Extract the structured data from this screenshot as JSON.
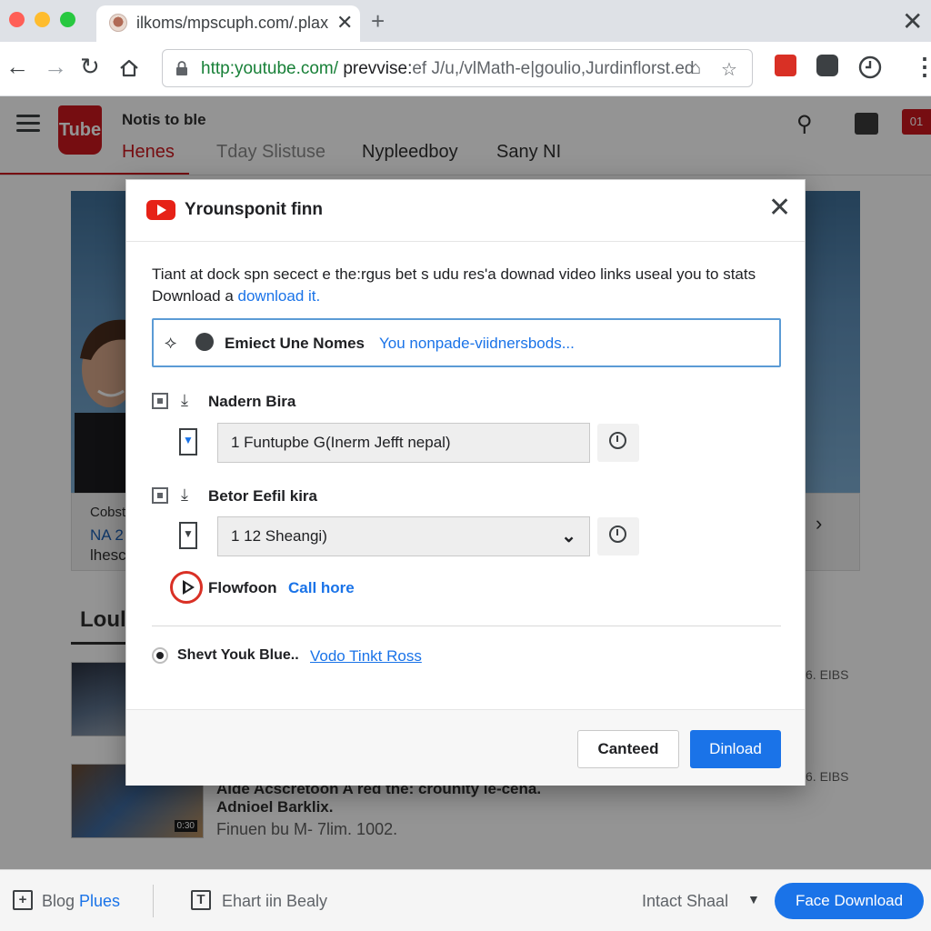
{
  "browser": {
    "tab_title": "ilkoms/mpscuph.com/.plax",
    "tab_close": "✕",
    "new_tab": "+",
    "window_close": "✕",
    "url_green": "http:youtube.com/",
    "url_dark": " prevvise:",
    "url_rest": "ef J/u,/vlMath-e|goulio,Jurdinflorst.ed"
  },
  "page": {
    "logo_text": "Tube",
    "brand": "Notis to ble",
    "nav": [
      "Henes",
      "Tday Slistuse",
      "Nypleedboy",
      "Sany NI"
    ],
    "badge": "01",
    "caption": [
      "Cobst",
      "NA 2",
      "lhesc"
    ],
    "section_title": "Loul",
    "videos": [
      {
        "title": "",
        "meta": "",
        "size": "6. EIBS"
      },
      {
        "title": "Aide Acscretoon A red the: crounity le-cena.",
        "meta_bold": "Adnioel Barklix.",
        "meta": "Finuen bu M- 7lim. 1002.",
        "size": "6. EIBS",
        "time": "0:30"
      }
    ]
  },
  "modal": {
    "title": "Yrounsponit finn",
    "close": "✕",
    "description_main": "Tiant at dock spn secect e the:rgus bet s udu res'a downad video links useal you to stats Download a ",
    "description_link": "download it.",
    "url_label": "Emiect Une Nomes",
    "url_value": "You nonpade-viidnersbods...",
    "option1_label": "Nadern Bira",
    "option1_value": "1  Funtupbe G(Inerm Jefft nepal)",
    "option2_label": "Betor Eefil kira",
    "option2_value": "1 12  Sheangi)",
    "format_label": "Flowfoon",
    "format_link": "Call hore",
    "radio_label": "Shevt Youk Blue..",
    "radio_link": "Vodo Tinkt Ross",
    "cancel_label": "Canteed",
    "download_label": "Dinload"
  },
  "bottom": {
    "left_text": "Blog ",
    "left_text_blue": "Plues",
    "middle_text": "Ehart iin Bealy",
    "right_text": "Intact Shaal",
    "button_label": "Face Download"
  },
  "colors": {
    "accent": "#1a73e8",
    "youtube_red": "#cc181e",
    "close_red": "#ff5f57",
    "minimize_yellow": "#febc2e",
    "maximize_green": "#28c840"
  }
}
